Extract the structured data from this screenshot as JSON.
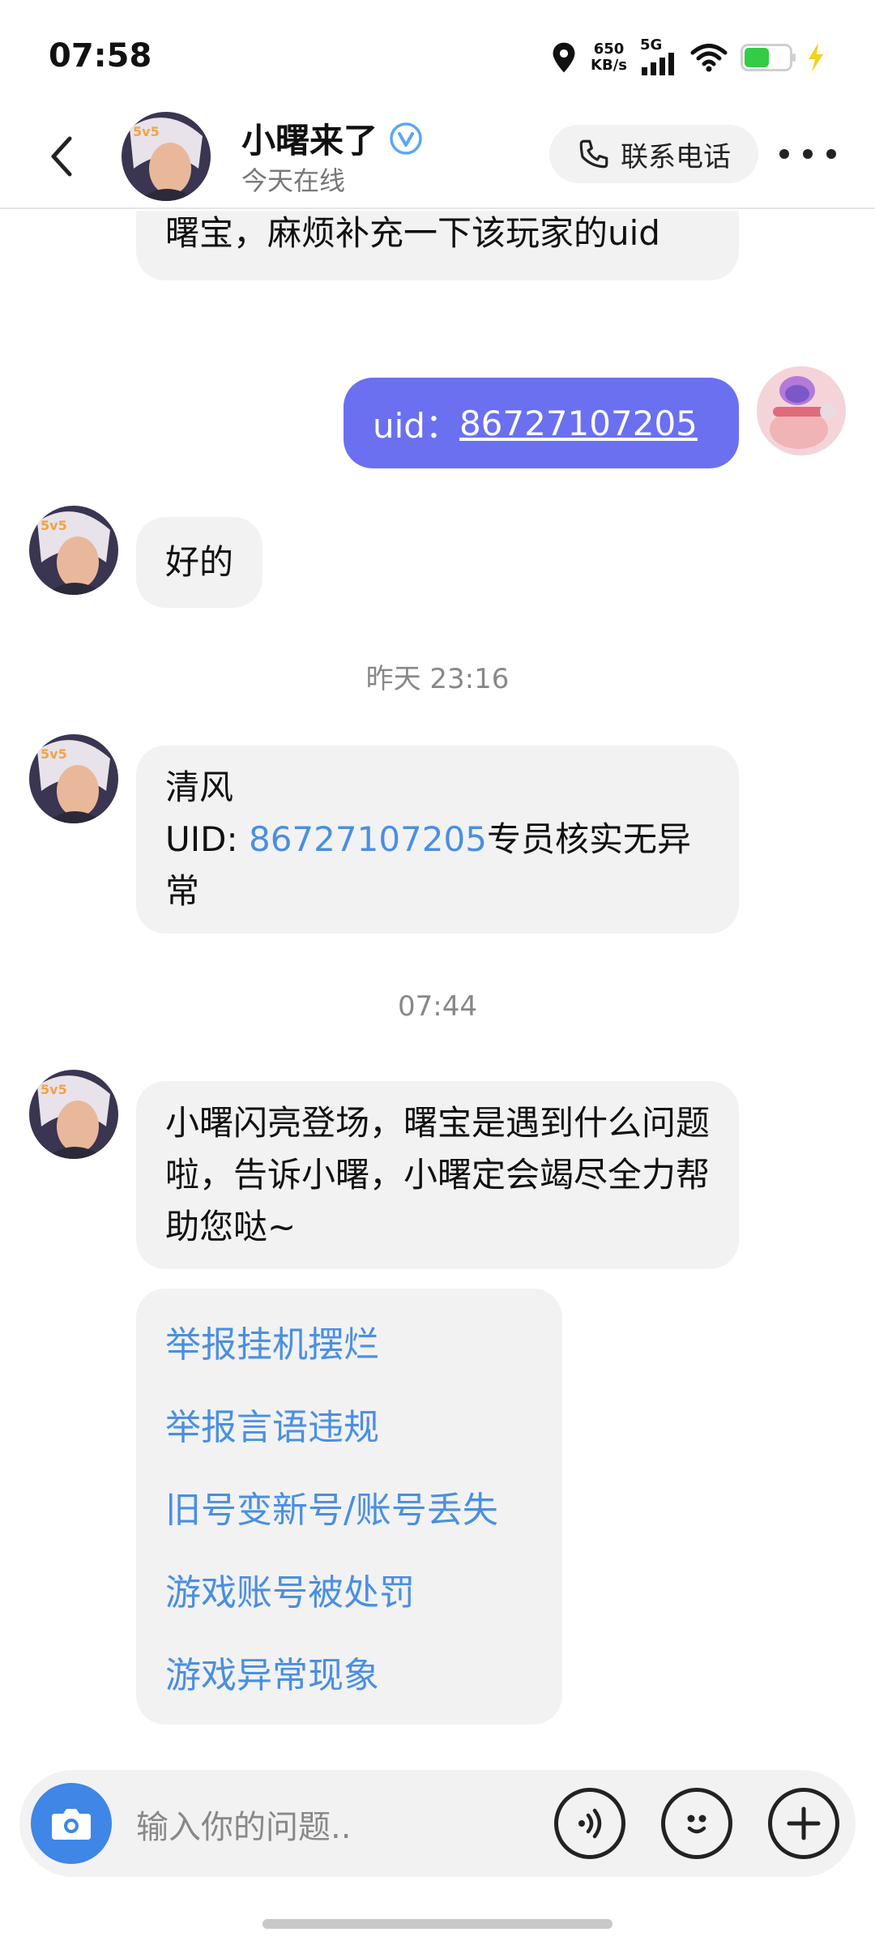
{
  "status_bar": {
    "time": "07:58",
    "net_speed_value": "650",
    "net_speed_unit": "KB/s",
    "network_type": "5G"
  },
  "header": {
    "name": "小曙来了",
    "online_status": "今天在线",
    "call_label": "联系电话",
    "verified_color": "#5aa7f2"
  },
  "messages": {
    "m1_text": "曙宝，麻烦补充一下该玩家的uid",
    "m2_prefix": "uid：",
    "m2_uid": "86727107205",
    "m3_text": "好的",
    "time1": "昨天 23:16",
    "m4_line1": "清风",
    "m4_uid_prefix": "UID: ",
    "m4_uid": "86727107205",
    "m4_suffix": "专员核实无异常",
    "time2": "07:44",
    "m5_text": "小曙闪亮登场，曙宝是遇到什么问题啦，告诉小曙，小曙定会竭尽全力帮助您哒~"
  },
  "quick_options": [
    "举报挂机摆烂",
    "举报言语违规",
    "旧号变新号/账号丢失",
    "游戏账号被处罚",
    "游戏异常现象"
  ],
  "input": {
    "placeholder": "输入你的问题.."
  },
  "colors": {
    "outgoing_bubble": "#6a70f0",
    "link": "#4a8fe0",
    "camera_button": "#3f86e6"
  }
}
